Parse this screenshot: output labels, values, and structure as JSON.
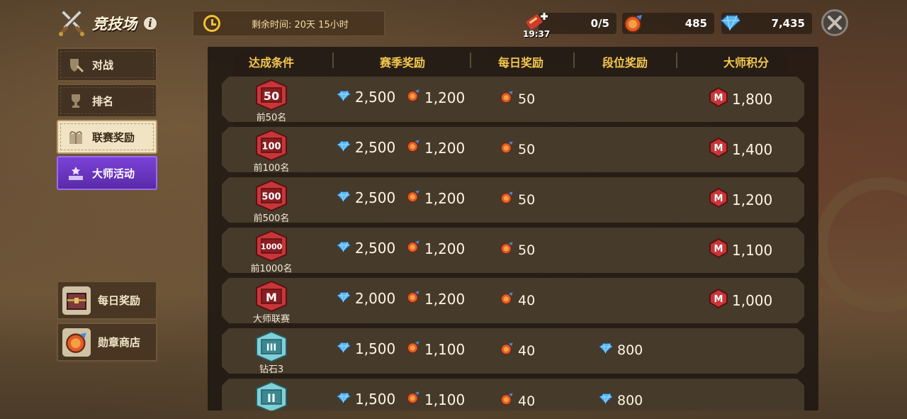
{
  "header": {
    "title": "竞技场",
    "timer_text": "剩余时间: 20天 15小时",
    "ticket_time": "19:37",
    "ticket_count": "0/5",
    "medal_count": "485",
    "gem_count": "7,435"
  },
  "sidebar": {
    "items": [
      {
        "label": "对战",
        "icon": "shield-sword-icon"
      },
      {
        "label": "排名",
        "icon": "trophy-icon"
      },
      {
        "label": "联赛奖励",
        "icon": "gift-icon"
      },
      {
        "label": "大师活动",
        "icon": "podium-icon"
      }
    ],
    "daily_reward": "每日奖励",
    "medal_shop": "勋章商店"
  },
  "table": {
    "headers": [
      "达成条件",
      "赛季奖励",
      "每日奖励",
      "段位奖励",
      "大师积分"
    ],
    "rows": [
      {
        "badge": "50",
        "tier": "前50名",
        "season_gems": "2,500",
        "season_medals": "1,200",
        "daily_medals": "50",
        "rank_gems": "",
        "master_points": "1,800"
      },
      {
        "badge": "100",
        "tier": "前100名",
        "season_gems": "2,500",
        "season_medals": "1,200",
        "daily_medals": "50",
        "rank_gems": "",
        "master_points": "1,400"
      },
      {
        "badge": "500",
        "tier": "前500名",
        "season_gems": "2,500",
        "season_medals": "1,200",
        "daily_medals": "50",
        "rank_gems": "",
        "master_points": "1,200"
      },
      {
        "badge": "1000",
        "tier": "前1000名",
        "season_gems": "2,500",
        "season_medals": "1,200",
        "daily_medals": "50",
        "rank_gems": "",
        "master_points": "1,100"
      },
      {
        "badge": "M",
        "tier": "大师联赛",
        "season_gems": "2,000",
        "season_medals": "1,200",
        "daily_medals": "40",
        "rank_gems": "",
        "master_points": "1,000"
      },
      {
        "badge": "III",
        "tier": "钻石3",
        "season_gems": "1,500",
        "season_medals": "1,100",
        "daily_medals": "40",
        "rank_gems": "800",
        "master_points": ""
      },
      {
        "badge": "II",
        "tier": "",
        "season_gems": "1,500",
        "season_medals": "1,100",
        "daily_medals": "40",
        "rank_gems": "800",
        "master_points": ""
      }
    ]
  },
  "colors": {
    "header_gold": "#f5c850",
    "badge_red": "#c8363a",
    "badge_diamond": "#7fd0d8",
    "active_tab_bg": "#f0e4c4",
    "event_purple": "#6a34c0"
  }
}
